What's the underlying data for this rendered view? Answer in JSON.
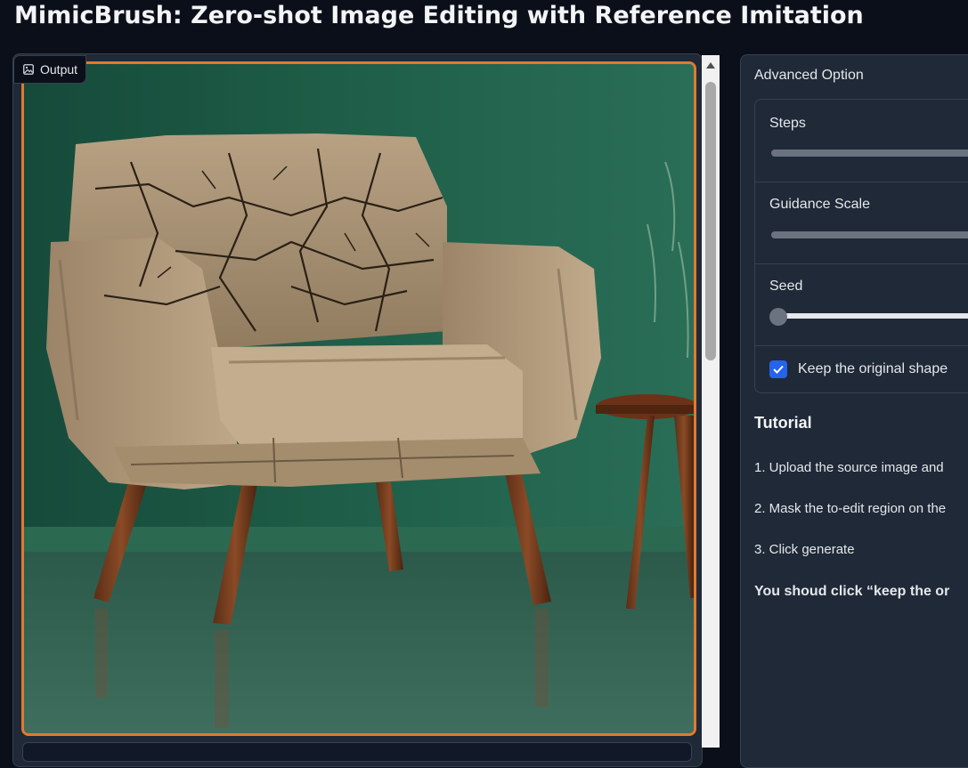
{
  "page": {
    "title": "MimicBrush: Zero-shot Image Editing with Reference Imitation"
  },
  "output": {
    "label": "Output",
    "label_icon": "image-icon",
    "frame_color": "#e07a2f"
  },
  "advanced": {
    "label": "Advanced Option",
    "steps_label": "Steps",
    "guidance_label": "Guidance Scale",
    "seed_label": "Seed",
    "keep_shape_label": "Keep the original shape",
    "keep_shape_checked": true
  },
  "tutorial": {
    "title": "Tutorial",
    "steps": [
      "1. Upload the source image and",
      "2. Mask the to-edit region on the",
      "3. Click generate"
    ],
    "note": "You shoud click “keep the or"
  },
  "colors": {
    "background": "#0b0f19",
    "panel": "#1f2937",
    "accent_checkbox": "#2563eb"
  }
}
